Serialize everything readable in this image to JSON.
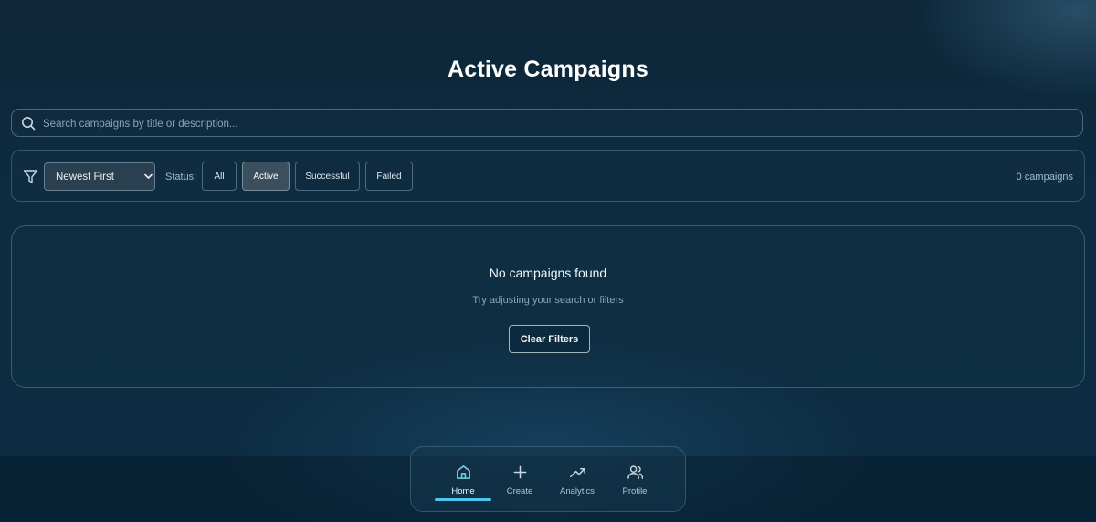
{
  "page": {
    "title": "Active Campaigns"
  },
  "search": {
    "placeholder": "Search campaigns by title or description...",
    "value": ""
  },
  "filters": {
    "sort_options": [
      "Newest First"
    ],
    "sort_selected": "Newest First",
    "status_label": "Status:",
    "status_chips": [
      {
        "label": "All",
        "active": false
      },
      {
        "label": "Active",
        "active": true
      },
      {
        "label": "Successful",
        "active": false
      },
      {
        "label": "Failed",
        "active": false
      }
    ],
    "count_text": "0 campaigns"
  },
  "empty_state": {
    "title": "No campaigns found",
    "subtitle": "Try adjusting your search or filters",
    "button_label": "Clear Filters"
  },
  "bottom_nav": {
    "items": [
      {
        "label": "Home",
        "icon": "home-icon",
        "selected": true
      },
      {
        "label": "Create",
        "icon": "plus-icon",
        "selected": false
      },
      {
        "label": "Analytics",
        "icon": "trending-up-icon",
        "selected": false
      },
      {
        "label": "Profile",
        "icon": "users-icon",
        "selected": false
      }
    ]
  },
  "colors": {
    "background": "#0e2c41",
    "accent": "#4cc6ea",
    "chip_active": "#3b4f5e"
  }
}
